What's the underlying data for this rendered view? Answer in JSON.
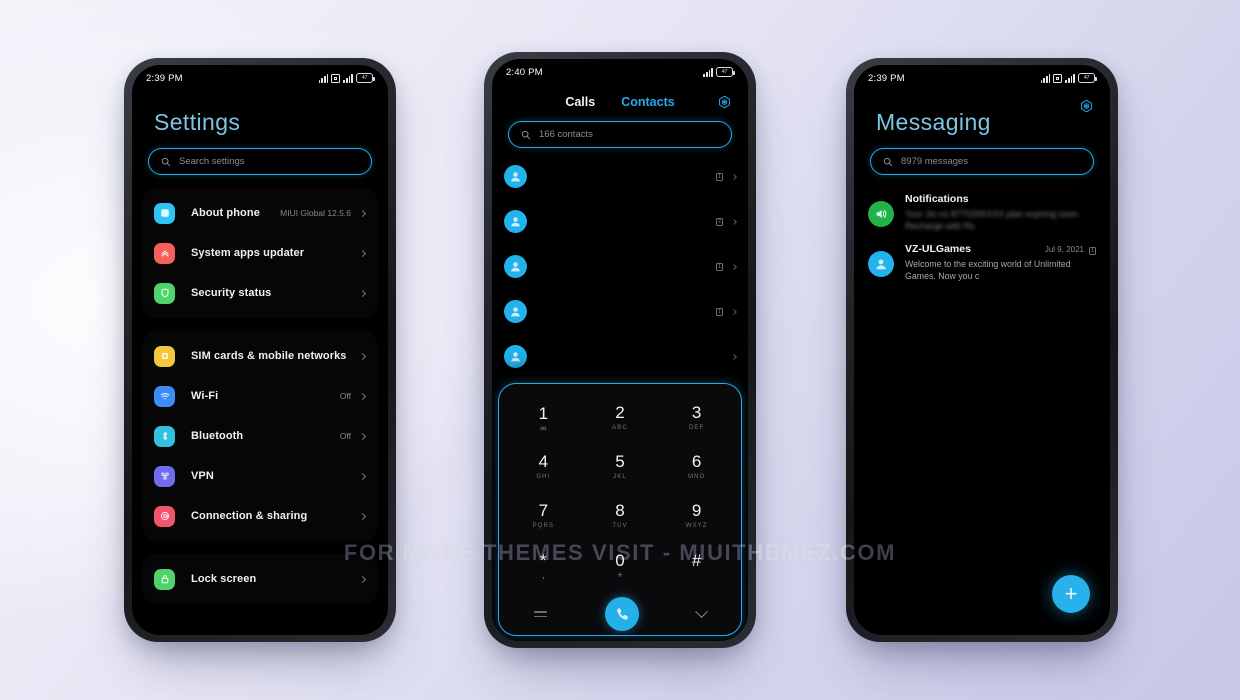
{
  "watermark": "FOR MORE THEMES VISIT - MIUITHEMEZ.COM",
  "theme": {
    "accent": "#2aa8e8",
    "title_color": "#7cc6e4",
    "screen_bg": "#000000",
    "background": "#d4d5ec"
  },
  "phones": {
    "settings": {
      "status": {
        "time": "2:39 PM",
        "battery": "47"
      },
      "title": "Settings",
      "search": {
        "placeholder": "Search settings",
        "icon": "search-icon"
      },
      "groups": [
        {
          "items": [
            {
              "label": "About phone",
              "value": "MIUI Global 12.5.6",
              "icon": "about-phone-icon",
              "color": "#2ec4f3"
            },
            {
              "label": "System apps updater",
              "value": "",
              "icon": "updater-icon",
              "color": "#f4605a"
            },
            {
              "label": "Security status",
              "value": "",
              "icon": "shield-icon",
              "color": "#4ed46a"
            }
          ]
        },
        {
          "items": [
            {
              "label": "SIM cards & mobile networks",
              "value": "",
              "icon": "sim-card-icon",
              "color": "#f2c73c"
            },
            {
              "label": "Wi-Fi",
              "value": "Off",
              "icon": "wifi-icon",
              "color": "#3d8bf5"
            },
            {
              "label": "Bluetooth",
              "value": "Off",
              "icon": "bluetooth-icon",
              "color": "#31c2e0"
            },
            {
              "label": "VPN",
              "value": "",
              "icon": "vpn-icon",
              "color": "#6f6cf0"
            },
            {
              "label": "Connection & sharing",
              "value": "",
              "icon": "connection-sharing-icon",
              "color": "#f2556b"
            }
          ]
        },
        {
          "items": [
            {
              "label": "Lock screen",
              "value": "",
              "icon": "lock-icon",
              "color": "#4ed46a"
            }
          ]
        }
      ]
    },
    "dialer": {
      "status": {
        "time": "2:40 PM",
        "battery": "47"
      },
      "tabs": [
        {
          "label": "Calls",
          "active": false
        },
        {
          "label": "Contacts",
          "active": true
        }
      ],
      "settings_icon": "gear-icon",
      "search": {
        "placeholder": "166 contacts",
        "icon": "search-icon"
      },
      "contacts": [
        {
          "name": "",
          "detail": "",
          "sim": "1",
          "blurred": true
        },
        {
          "name": "",
          "detail": "",
          "sim": "2",
          "blurred": true
        },
        {
          "name": "",
          "detail": "",
          "sim": "1",
          "blurred": true
        },
        {
          "name": "",
          "detail": "",
          "sim": "1",
          "blurred": true
        },
        {
          "name": "",
          "detail": "",
          "sim": "1",
          "blurred": true
        }
      ],
      "keypad": [
        {
          "num": "1",
          "sub": "∞",
          "sym": true
        },
        {
          "num": "2",
          "sub": "ABC",
          "sym": false
        },
        {
          "num": "3",
          "sub": "DEF",
          "sym": false
        },
        {
          "num": "4",
          "sub": "GHI",
          "sym": false
        },
        {
          "num": "5",
          "sub": "JKL",
          "sym": false
        },
        {
          "num": "6",
          "sub": "MNO",
          "sym": false
        },
        {
          "num": "7",
          "sub": "PQRS",
          "sym": false
        },
        {
          "num": "8",
          "sub": "TUV",
          "sym": false
        },
        {
          "num": "9",
          "sub": "WXYZ",
          "sym": false
        },
        {
          "num": "*",
          "sub": ",",
          "sym": true
        },
        {
          "num": "0",
          "sub": "+",
          "sym": true
        },
        {
          "num": "#",
          "sub": "",
          "sym": true
        }
      ],
      "actions": {
        "keyboard_icon": "keyboard-icon",
        "call_icon": "call-icon",
        "collapse_icon": "chevron-down-icon"
      }
    },
    "messaging": {
      "status": {
        "time": "2:39 PM",
        "battery": "47"
      },
      "title": "Messaging",
      "settings_icon": "gear-icon",
      "search": {
        "placeholder": "8979 messages",
        "icon": "search-icon"
      },
      "threads": [
        {
          "title": "Notifications",
          "date": "",
          "preview": "Your Jio no 877029XXXX plan expiring soon. Recharge with Rs",
          "blurred": true,
          "icon": "speaker-icon",
          "color": "#21b34a"
        },
        {
          "title": "VZ-ULGames",
          "date": "Jul 9, 2021",
          "preview": "Welcome to the exciting world of Unlimited Games. Now you c",
          "blurred": false,
          "icon": "contact-avatar-icon",
          "color": "#22b2ec",
          "sim": "1"
        }
      ],
      "fab": {
        "label": "+",
        "icon": "add-icon"
      }
    }
  }
}
